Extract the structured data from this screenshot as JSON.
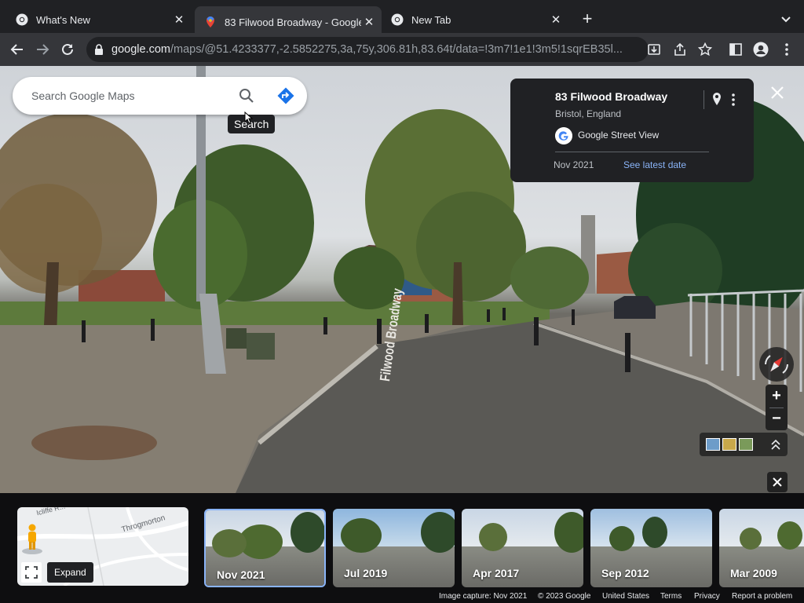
{
  "browser": {
    "tabs": [
      {
        "title": "What's New",
        "active": false
      },
      {
        "title": "83 Filwood Broadway - Google",
        "active": true
      },
      {
        "title": "New Tab",
        "active": false
      }
    ],
    "url_host": "google.com",
    "url_path": "/maps/@51.4233377,-2.5852275,3a,75y,306.81h,83.64t/data=!3m7!1e1!3m5!1sqrEB35l..."
  },
  "search": {
    "placeholder": "Search Google Maps",
    "tooltip": "Search"
  },
  "info_card": {
    "title": "83 Filwood Broadway",
    "subtitle": "Bristol, England",
    "source": "Google Street View",
    "date": "Nov 2021",
    "latest_link": "See latest date"
  },
  "scene": {
    "road_marking": "Filwood Broadway"
  },
  "minimap": {
    "street_1": "Throgmorton",
    "street_2": "Icliffe R..."
  },
  "expand_tip": "Expand",
  "timeline": [
    {
      "label": "Nov 2021",
      "selected": true
    },
    {
      "label": "Jul 2019",
      "selected": false
    },
    {
      "label": "Apr 2017",
      "selected": false
    },
    {
      "label": "Sep 2012",
      "selected": false
    },
    {
      "label": "Mar 2009",
      "selected": false
    }
  ],
  "footer": {
    "capture": "Image capture: Nov 2021",
    "copyright": "© 2023 Google",
    "region": "United States",
    "terms": "Terms",
    "privacy": "Privacy",
    "report": "Report a problem"
  },
  "colors": {
    "accent_link": "#8ab4f8",
    "chrome_bg": "#202124",
    "toolbar_bg": "#35363a",
    "directions_blue": "#1a73e8"
  }
}
